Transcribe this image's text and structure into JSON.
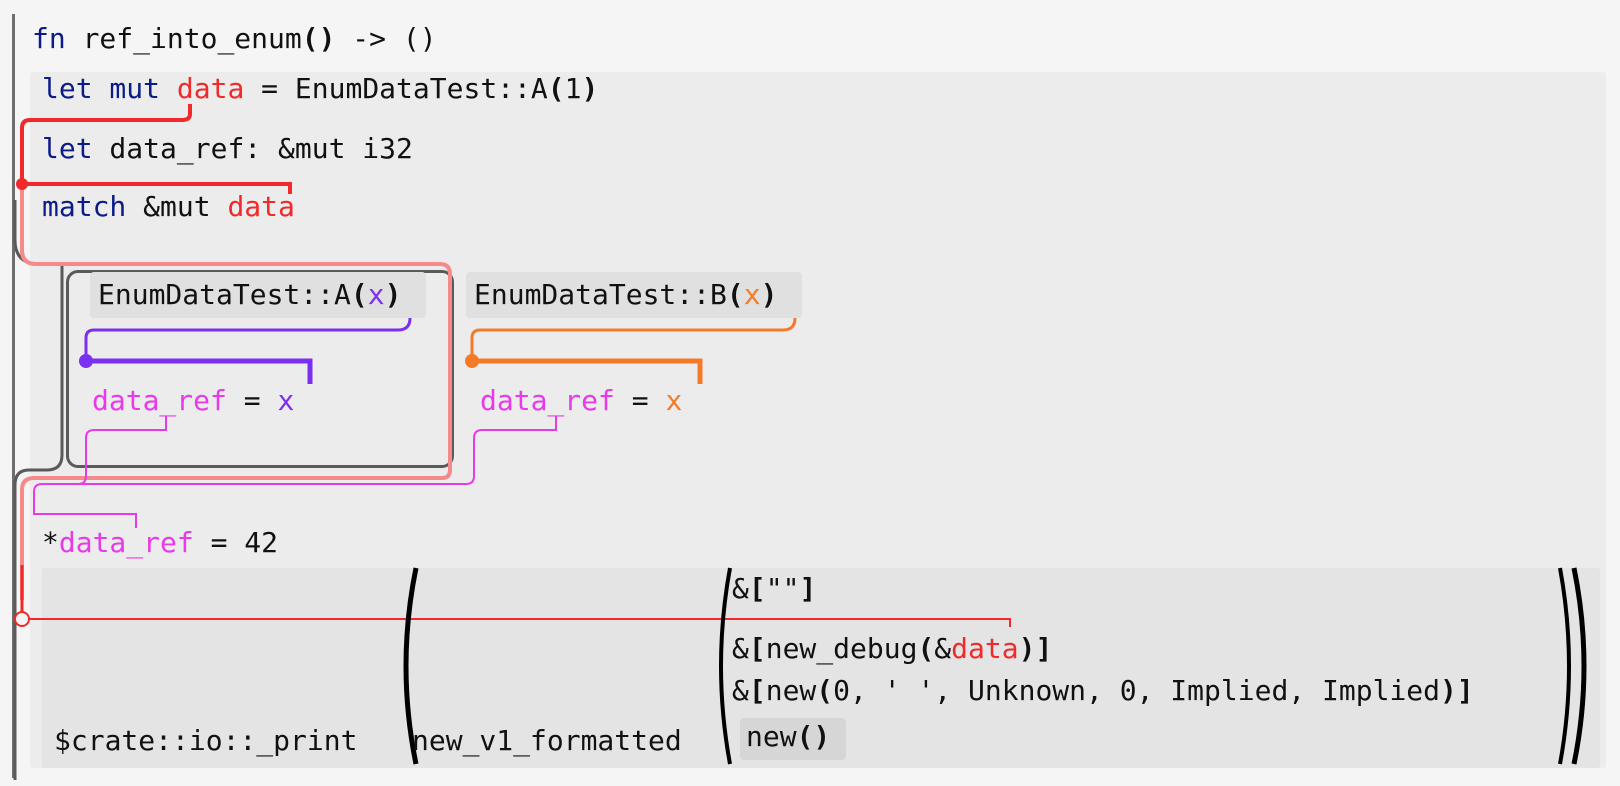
{
  "fn_header": {
    "keyword": "fn",
    "name": "ref_into_enum",
    "open_paren": "(",
    "close_paren": ")",
    "arrow": " -> ()"
  },
  "line1": {
    "kw": "let mut",
    "var": "data",
    "rest": " = EnumDataTest::A",
    "open": "(",
    "arg": "1",
    "close": ")"
  },
  "line2": {
    "kw": "let",
    "rest": " data_ref: &mut i32"
  },
  "line3": {
    "kw": "match",
    "rest": " &mut ",
    "var": "data"
  },
  "arm_a": {
    "pattern_prefix": "EnumDataTest::A",
    "open": "(",
    "binding": "x",
    "close": ")",
    "assign_lhs": "data_ref",
    "assign_op": " = ",
    "assign_rhs": "x"
  },
  "arm_b": {
    "pattern_prefix": "EnumDataTest::B",
    "open": "(",
    "binding": "x",
    "close": ")",
    "assign_lhs": "data_ref",
    "assign_op": " = ",
    "assign_rhs": "x"
  },
  "deref_line": {
    "star": "*",
    "var": "data_ref",
    "rest": " = 42"
  },
  "print_call": {
    "func": "$crate::io::_print",
    "inner_func": "new_v1_formatted",
    "arg1_prefix": "&",
    "arg1_open": "[",
    "arg1_body": "\"\"",
    "arg1_close": "]",
    "arg2_prefix": "&",
    "arg2_open": "[",
    "arg2_func": "new_debug",
    "arg2_paren_open": "(",
    "arg2_amp": "&",
    "arg2_var": "data",
    "arg2_paren_close": ")",
    "arg2_close": "]",
    "arg3_prefix": "&",
    "arg3_open": "[",
    "arg3_func": "new",
    "arg3_paren_open": "(",
    "arg3_args": "0, ' ', Unknown, 0, Implied, Implied",
    "arg3_paren_close": ")",
    "arg3_close": "]",
    "arg4": "new",
    "arg4_parens": "()"
  },
  "colors": {
    "keyword": "#0b1c87",
    "data_var": "#f02a2a",
    "data_region_light": "#f58a8a",
    "binding_a": "#7b2ff0",
    "binding_b": "#f57a28",
    "data_ref": "#e83ae8",
    "block_border": "#5a5a5a",
    "block_bg": "#ececec"
  }
}
